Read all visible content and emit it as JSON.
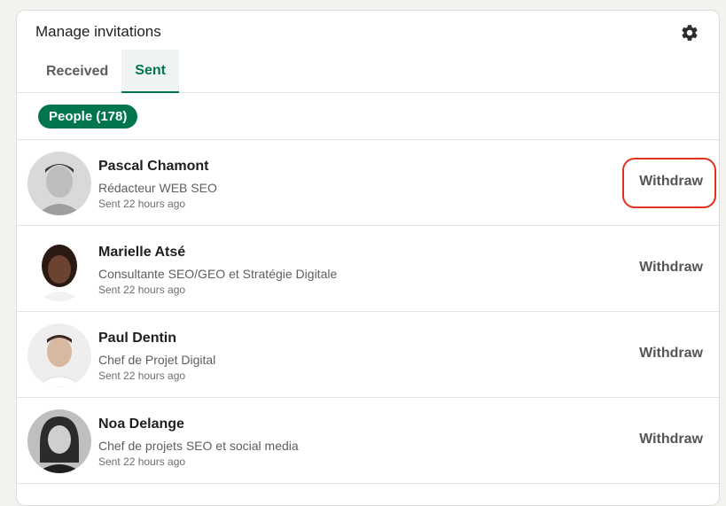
{
  "header": {
    "title": "Manage invitations",
    "settings_icon": "gear-icon"
  },
  "tabs": [
    {
      "label": "Received",
      "active": false
    },
    {
      "label": "Sent",
      "active": true
    }
  ],
  "filter": {
    "label": "People (178)"
  },
  "colors": {
    "accent": "#01754f",
    "highlight": "#e0301e"
  },
  "invitations": [
    {
      "name": "Pascal Chamont",
      "headline": "Rédacteur WEB SEO",
      "sent": "Sent 22 hours ago",
      "action": "Withdraw",
      "highlighted": true
    },
    {
      "name": "Marielle Atsé",
      "headline": "Consultante SEO/GEO et Stratégie Digitale",
      "sent": "Sent 22 hours ago",
      "action": "Withdraw"
    },
    {
      "name": "Paul Dentin",
      "headline": "Chef de Projet Digital",
      "sent": "Sent 22 hours ago",
      "action": "Withdraw"
    },
    {
      "name": "Noa Delange",
      "headline": "Chef de projets SEO et social media",
      "sent": "Sent 22 hours ago",
      "action": "Withdraw"
    }
  ]
}
